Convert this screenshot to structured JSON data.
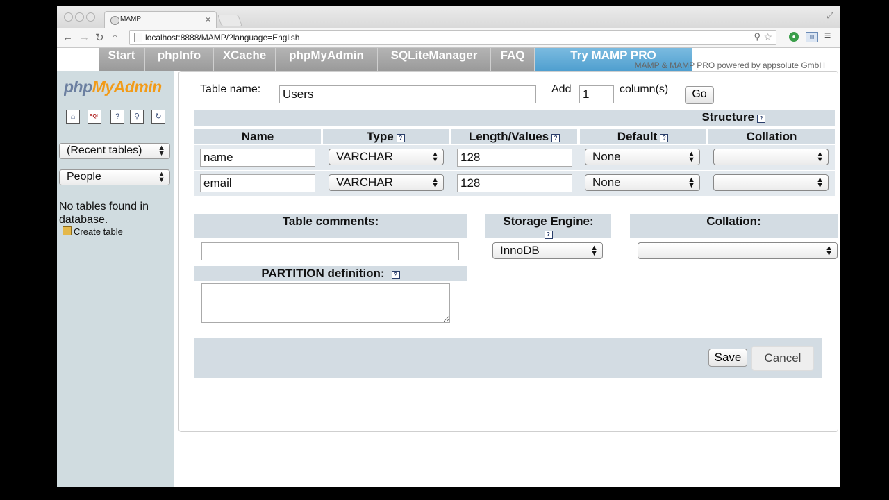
{
  "browser": {
    "tab_title": "MAMP",
    "tab_close": "×",
    "url": "localhost:8888/MAMP/?language=English"
  },
  "mamp_nav": {
    "items": [
      "Start",
      "phpInfo",
      "XCache",
      "phpMyAdmin",
      "SQLiteManager",
      "FAQ",
      "Try MAMP PRO"
    ],
    "powered": "MAMP & MAMP PRO powered by appsolute GmbH"
  },
  "sidebar": {
    "logo_php": "php",
    "logo_myadmin": "MyAdmin",
    "recent_tables": "(Recent tables)",
    "database": "People",
    "no_tables": "No tables found in database.",
    "create_table": "Create table"
  },
  "form": {
    "table_name_label": "Table name:",
    "table_name_value": "Users",
    "add_label": "Add",
    "add_value": "1",
    "columns_label": "column(s)",
    "go_label": "Go",
    "structure_label": "Structure",
    "headers": [
      "Name",
      "Type",
      "Length/Values",
      "Default",
      "Collation"
    ],
    "rows": [
      {
        "name": "name",
        "type": "VARCHAR",
        "length": "128",
        "default": "None",
        "collation": ""
      },
      {
        "name": "email",
        "type": "VARCHAR",
        "length": "128",
        "default": "None",
        "collation": ""
      }
    ],
    "table_comments_label": "Table comments:",
    "table_comments_value": "",
    "storage_engine_label": "Storage Engine:",
    "storage_engine_value": "InnoDB",
    "collation_label": "Collation:",
    "collation_value": "",
    "partition_label": "PARTITION definition:",
    "partition_value": "",
    "save_label": "Save",
    "cancel_label": "Cancel",
    "help_glyph": "?"
  }
}
